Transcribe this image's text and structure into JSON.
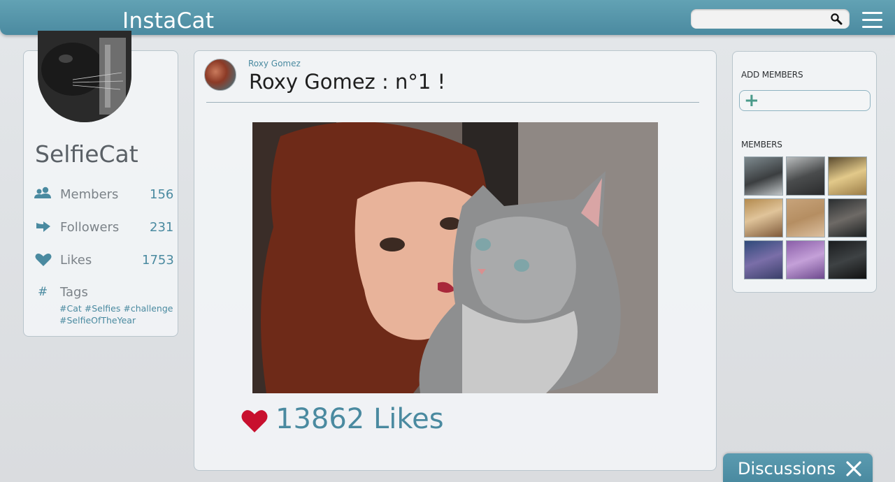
{
  "app": {
    "title": "InstaCat",
    "search_placeholder": ""
  },
  "profile": {
    "name": "SelfieCat",
    "stats": [
      {
        "label": "Members",
        "value": "156",
        "icon": "members-icon"
      },
      {
        "label": "Followers",
        "value": "231",
        "icon": "followers-arrow-icon"
      },
      {
        "label": "Likes",
        "value": "1753",
        "icon": "heart-icon"
      }
    ],
    "tags_label": "Tags",
    "tags_symbol": "#",
    "tags": "#Cat #Selfies #challenge #SelfieOfTheYear"
  },
  "post": {
    "author": "Roxy Gomez",
    "title": "Roxy Gomez : n°1 !",
    "likes_text": "13862 Likes",
    "like_color": "#c8102e"
  },
  "sidebar": {
    "add_members_label": "ADD MEMBERS",
    "add_symbol": "+",
    "members_label": "MEMBERS",
    "member_count_shown": 9
  },
  "discussions": {
    "label": "Discussions",
    "close_symbol": "✕"
  },
  "colors": {
    "accent": "#4a8aa0",
    "topbar": "#5a9bb0"
  }
}
